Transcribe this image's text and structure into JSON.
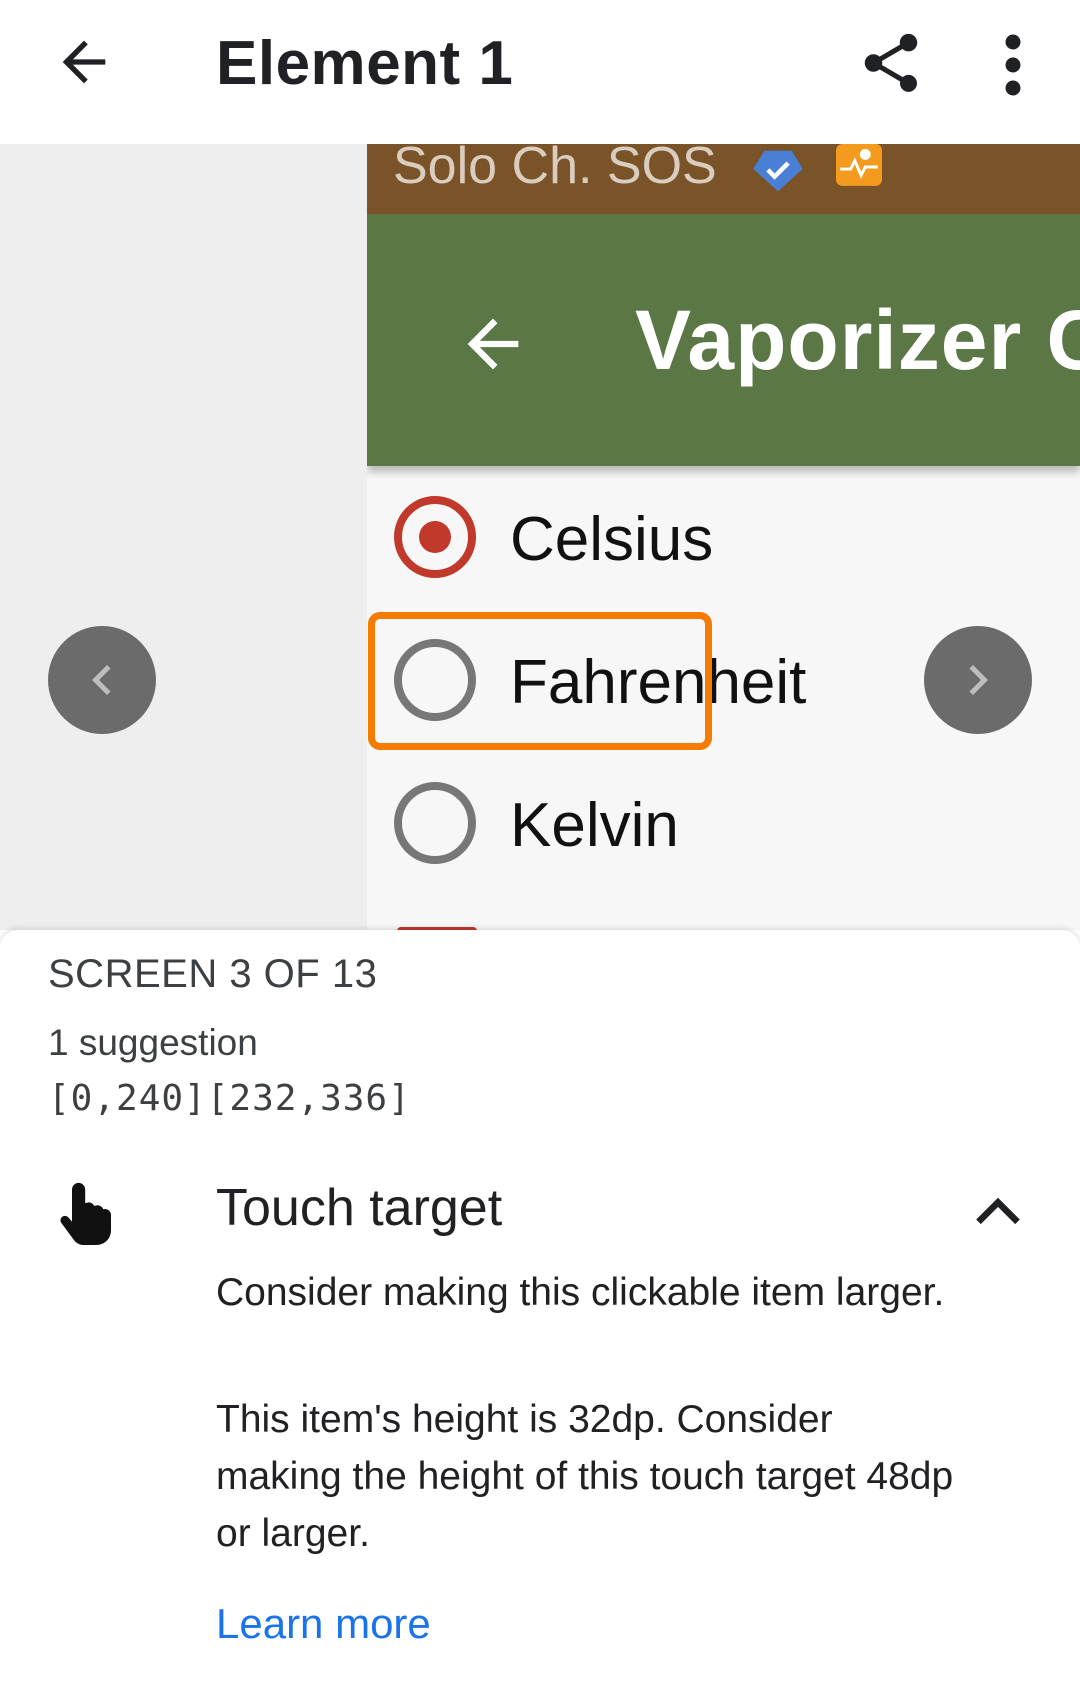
{
  "app_bar": {
    "title": "Element 1",
    "back_icon": "arrow-back-icon",
    "share_icon": "share-icon",
    "more_icon": "more-vert-icon"
  },
  "preview": {
    "status_bar_text": "Solo Ch. SOS",
    "status_icons": [
      "verified-shield-icon",
      "app-notification-icon"
    ],
    "toolbar_title": "Vaporizer C",
    "options": [
      {
        "label": "Celsius",
        "selected": true
      },
      {
        "label": "Fahrenheit",
        "selected": false
      },
      {
        "label": "Kelvin",
        "selected": false
      }
    ],
    "highlight_color": "#f57c00",
    "toolbar_color": "#5a7745",
    "status_bar_color": "#7a5428",
    "radio_checked_color": "#c0392b"
  },
  "details": {
    "screen_position": "SCREEN 3 OF 13",
    "suggestion_count": "1 suggestion",
    "bounds": "[0,240][232,336]",
    "rule_title": "Touch target",
    "rule_icon": "touch-hand-icon",
    "rule_description": "Consider making this clickable item larger.",
    "rule_detail": "This item's height is 32dp. Consider making the height of this touch target 48dp or larger.",
    "learn_more": "Learn more",
    "link_color": "#1a73e8"
  }
}
